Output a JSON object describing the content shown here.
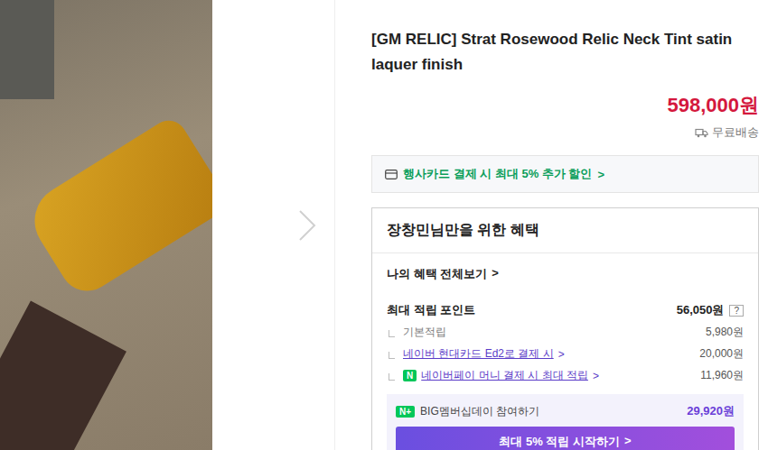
{
  "product": {
    "title": "[GM RELIC] Strat Rosewood Relic Neck Tint satin laquer finish",
    "price": "598,000원",
    "shipping": "무료배송"
  },
  "promo": {
    "label": "행사카드 결제 시 최대 5% 추가 할인",
    "arrow": ">"
  },
  "benefits": {
    "title": "장창민님만을 위한 혜택",
    "view_all": "나의 혜택 전체보기",
    "view_all_arrow": ">",
    "max_points": {
      "label": "최대 적립 포인트",
      "value": "56,050원",
      "help": "?"
    },
    "rows": [
      {
        "kind": "plain",
        "label": "기본적립",
        "arrow": "",
        "badge": "",
        "value": "5,980원"
      },
      {
        "kind": "link",
        "label": "네이버 현대카드 Ed2로 결제 시",
        "arrow": ">",
        "badge": "",
        "value": "20,000원"
      },
      {
        "kind": "npay",
        "label": "네이버페이 머니 결제 시 최대 적립",
        "arrow": ">",
        "badge": "N",
        "value": "11,960원"
      }
    ],
    "membership": {
      "badge": "N+",
      "label": "BIG멤버십데이 참여하기",
      "value": "29,920원",
      "button": "최대 5% 적립 시작하기",
      "button_arrow": ">"
    }
  }
}
